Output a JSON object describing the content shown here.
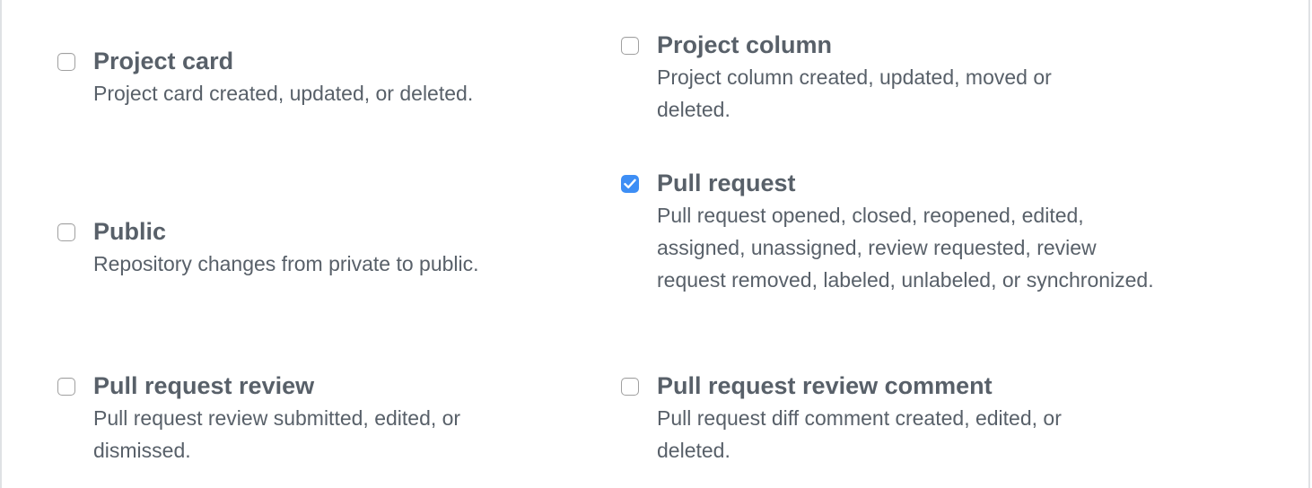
{
  "options": [
    {
      "id": "project-card",
      "title": "Project card",
      "description": "Project card created, updated, or deleted.",
      "checked": false
    },
    {
      "id": "project-column",
      "title": "Project column",
      "description": "Project column created, updated, moved or deleted.",
      "checked": false
    },
    {
      "id": "public",
      "title": "Public",
      "description": "Repository changes from private to public.",
      "checked": false
    },
    {
      "id": "pull-request",
      "title": "Pull request",
      "description": "Pull request opened, closed, reopened, edited, assigned, unassigned, review requested, review request removed, labeled, unlabeled, or synchronized.",
      "checked": true
    },
    {
      "id": "pull-request-review",
      "title": "Pull request review",
      "description": "Pull request review submitted, edited, or dismissed.",
      "checked": false
    },
    {
      "id": "pull-request-review-comment",
      "title": "Pull request review comment",
      "description": "Pull request diff comment created, edited, or deleted.",
      "checked": false
    }
  ],
  "colors": {
    "text": "#586069",
    "checkbox_checked": "#3d8ef5",
    "checkbox_border": "#a0a0a0",
    "frame_border": "#dfe2e5"
  }
}
